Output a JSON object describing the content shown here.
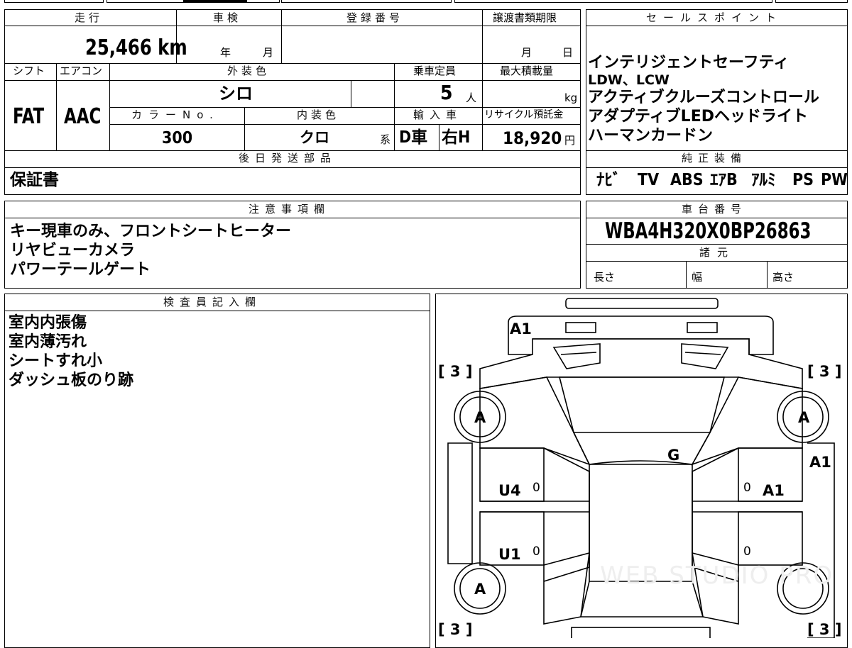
{
  "main": {
    "headers": {
      "mileage": "走行",
      "inspection": "車検",
      "registration_no": "登録番号",
      "transfer_deadline": "譲渡書類期限",
      "shift": "シフト",
      "aircon": "エアコン",
      "exterior_color": "外装色",
      "capacity": "乗車定員",
      "max_load": "最大積載量",
      "color_no": "カラーNo.",
      "interior_color": "内装色",
      "import": "輸入車",
      "recycle_fee": "リサイクル預託金"
    },
    "mileage_value": "25,466 km",
    "inspection_year_unit": "年",
    "inspection_month_unit": "月",
    "deadline_month_unit": "月",
    "deadline_day_unit": "日",
    "shift_value": "FAT",
    "aircon_value": "AAC",
    "exterior_color_value": "シロ",
    "capacity_value": "5",
    "capacity_unit": "人",
    "max_load_unit": "kg",
    "color_no_value": "300",
    "interior_color_value": "クロ",
    "interior_suffix": "系",
    "import_d": "D車",
    "import_h": "右H",
    "recycle_value": "18,920",
    "recycle_unit": "円"
  },
  "sales_points": {
    "header": "セールスポイント",
    "lines": [
      "インテリジェントセーフティ",
      "LDW、LCW",
      "アクティブクルーズコントロール",
      "アダプティブLEDヘッドライト",
      "ハーマンカードン"
    ]
  },
  "later_parts": {
    "header": "後日発送部品",
    "value": "保証書"
  },
  "genuine_equipment": {
    "header": "純正装備",
    "items": [
      "ﾅﾋﾞ",
      "TV",
      "ABS",
      "ｴｱB",
      "ｱﾙﾐ",
      "PS",
      "PW"
    ]
  },
  "notes": {
    "header": "注意事項欄",
    "lines": [
      "キー現車のみ、フロントシートヒーター",
      "リヤビューカメラ",
      "パワーテールゲート"
    ]
  },
  "chassis": {
    "header": "車台番号",
    "value": "WBA4H320X0BP26863"
  },
  "specs": {
    "header": "諸元",
    "length": "長さ",
    "width": "幅",
    "height": "高さ"
  },
  "inspector": {
    "header": "検査員記入欄",
    "lines": [
      "室内内張傷",
      "室内薄汚れ",
      "シートすれ小",
      "ダッシュ板のり跡"
    ]
  },
  "diagram": {
    "labels": {
      "front_bumper": "A1",
      "glass_left_top": "[ 3 ]",
      "glass_right_top": "[ 3 ]",
      "glass_left_bottom": "[ 3 ]",
      "glass_right_bottom": "[ 3 ]",
      "left_front_wheel": "A",
      "right_front_wheel": "A",
      "left_rear_wheel": "A",
      "roof": "G",
      "right_fender": "A1",
      "left_front_door": "U4",
      "right_front_door": "A1",
      "left_rear_door": "U1",
      "zero": "0"
    },
    "watermark": "WEB STUDIO PRO"
  }
}
